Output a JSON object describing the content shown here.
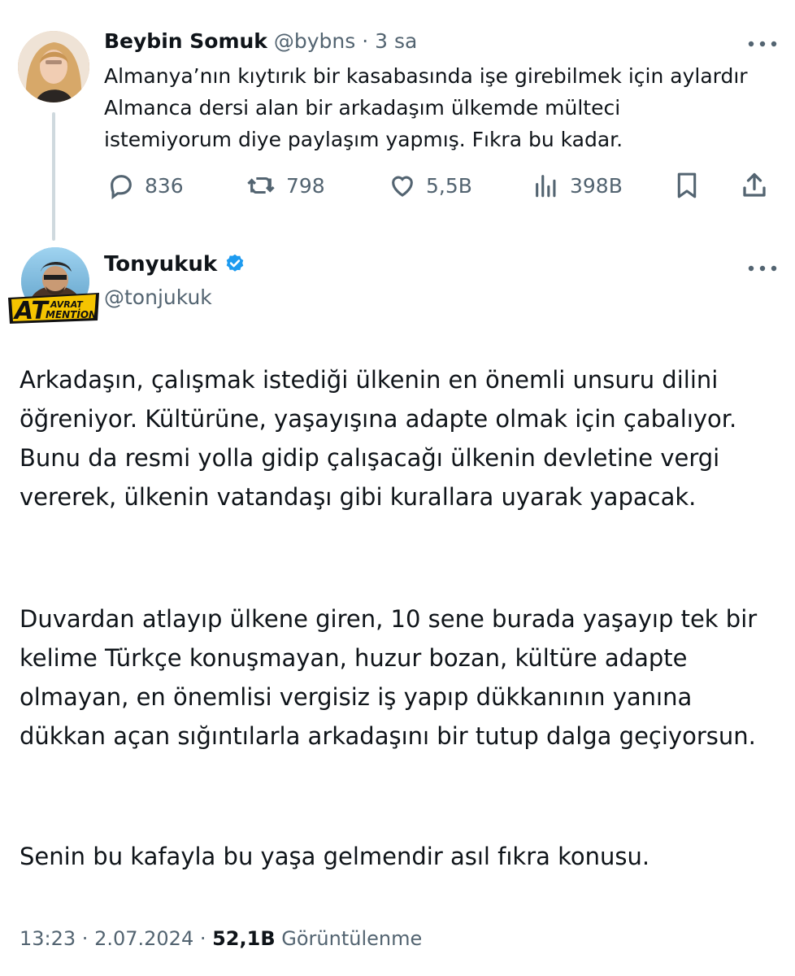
{
  "parent_tweet": {
    "display_name": "Beybin Somuk",
    "handle": "@bybns",
    "separator": "·",
    "time_ago": "3 sa",
    "text": "Almanya’nın kıytırık bir kasabasında işe girebilmek için aylardır Almanca dersi alan bir arkadaşım ülkemde mülteci istemiyorum diye paylaşım yapmış. Fıkra bu kadar.",
    "actions": {
      "replies": "836",
      "retweets": "798",
      "likes": "5,5B",
      "views": "398B"
    }
  },
  "main_tweet": {
    "display_name": "Tonyukuk",
    "verified": true,
    "handle": "@tonjukuk",
    "avatar_badge": {
      "line1": "AT",
      "line2a": "AVRAT",
      "line2b": "MENTİON"
    },
    "paragraphs": [
      "Arkadaşın, çalışmak istediği ülkenin en önemli unsuru dilini öğreniyor. Kültürüne, yaşayışına adapte olmak için çabalıyor. Bunu da resmi yolla gidip çalışacağı ülkenin devletine vergi vererek, ülkenin vatandaşı gibi kurallara uyarak yapacak.",
      "Duvardan atlayıp ülkene giren, 10 sene burada yaşayıp tek bir kelime Türkçe konuşmayan, huzur bozan, kültüre adapte olmayan, en önemlisi vergisiz iş yapıp dükkanının yanına dükkan açan sığıntılarla arkadaşını bir tutup dalga geçiyorsun.",
      "Senin bu kafayla bu yaşa gelmendir asıl fıkra konusu."
    ],
    "footer": {
      "time": "13:23",
      "separator1": " · ",
      "date": "2.07.2024",
      "separator2": " · ",
      "views_count": "52,1B",
      "views_label": "Görüntülenme"
    }
  },
  "colors": {
    "text_primary": "#0f1419",
    "text_secondary": "#536471",
    "verified_blue": "#1d9bf0",
    "thread_line": "#cfd9de"
  }
}
